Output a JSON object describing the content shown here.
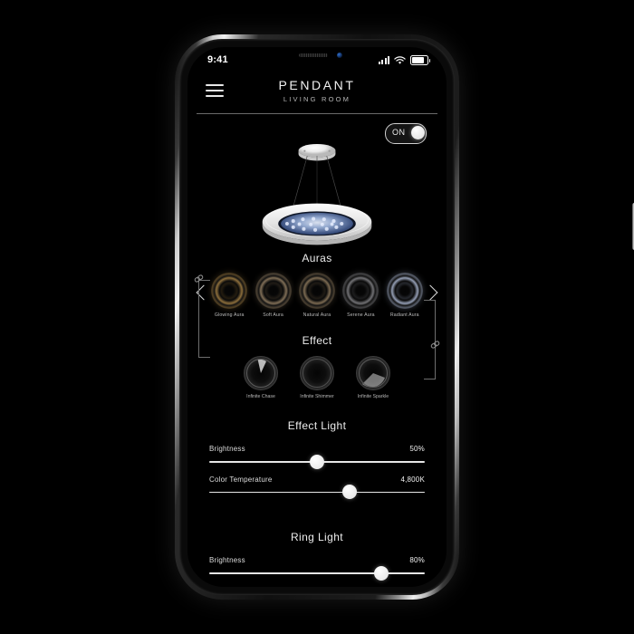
{
  "status_bar": {
    "time": "9:41",
    "signal_icon": "cellular-bars-icon",
    "wifi_icon": "wifi-icon",
    "battery_icon": "battery-icon"
  },
  "header": {
    "menu_icon": "hamburger-menu-icon",
    "title": "PENDANT",
    "subtitle": "LIVING ROOM"
  },
  "power_toggle": {
    "label": "ON",
    "state": "on"
  },
  "device_image": {
    "name": "pendant-lamp-illustration",
    "accent_led_color": "#7f9fd6"
  },
  "auras": {
    "section_title": "Auras",
    "prev_icon": "chevron-left-icon",
    "next_icon": "chevron-right-icon",
    "items": [
      {
        "label": "Glowing Aura",
        "color": "#b08a4a"
      },
      {
        "label": "Soft Aura",
        "color": "#a08a6c"
      },
      {
        "label": "Natural Aura",
        "color": "#9b8566"
      },
      {
        "label": "Serene Aura",
        "color": "#8e8e92"
      },
      {
        "label": "Radiant Aura",
        "color": "#b9c6e2"
      }
    ]
  },
  "effect": {
    "section_title": "Effect",
    "items": [
      {
        "label": "Infinite Chase"
      },
      {
        "label": "Infinite Shimmer"
      },
      {
        "label": "Infinite Sparkle"
      }
    ]
  },
  "effect_light": {
    "section_title": "Effect Light",
    "sliders": [
      {
        "name": "Brightness",
        "value": "50%",
        "percent": 50
      },
      {
        "name": "Color Temperature",
        "value": "4,800K",
        "percent": 65
      }
    ]
  },
  "ring_light": {
    "section_title": "Ring Light",
    "sliders": [
      {
        "name": "Brightness",
        "value": "80%",
        "percent": 80
      }
    ]
  },
  "link_controls": {
    "left_icon": "link-chain-icon",
    "right_icon": "link-chain-icon"
  }
}
